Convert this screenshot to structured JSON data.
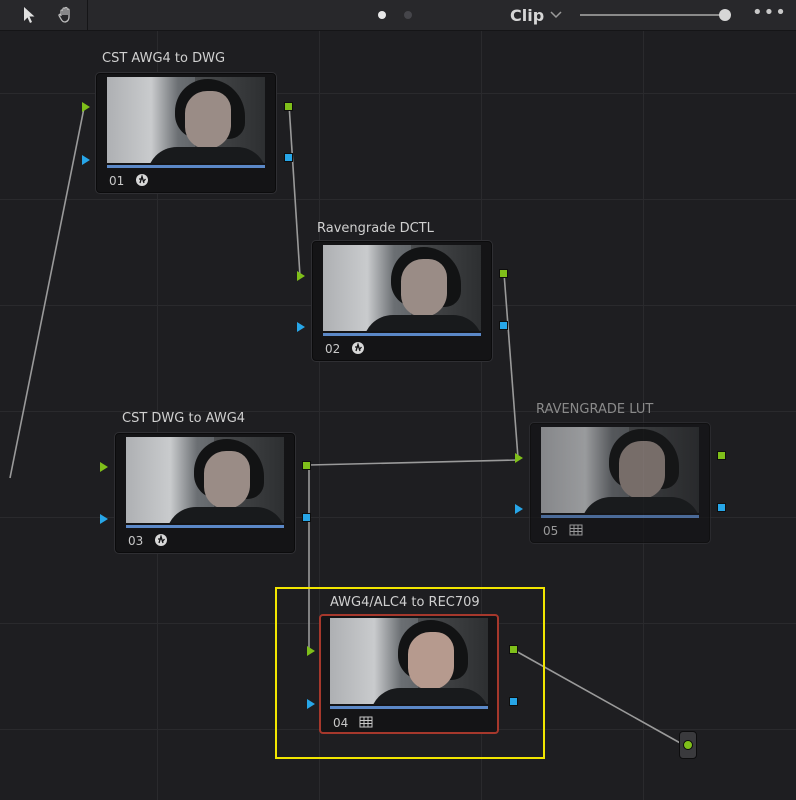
{
  "toolbar": {
    "pointer_icon": "pointer-arrow-icon",
    "hand_icon": "hand-pan-icon",
    "mode_label": "Clip",
    "more_icon": "more-dots-icon",
    "more_label": "•••"
  },
  "nodes": [
    {
      "title": "CST AWG4 to DWG",
      "number": "01",
      "icon": "fx-icon",
      "state": "normal"
    },
    {
      "title": "Ravengrade DCTL",
      "number": "02",
      "icon": "fx-icon",
      "state": "normal"
    },
    {
      "title": "CST DWG to AWG4",
      "number": "03",
      "icon": "fx-icon",
      "state": "normal"
    },
    {
      "title": "AWG4/ALC4 to REC709",
      "number": "04",
      "icon": "lut-grid-icon",
      "state": "selected"
    },
    {
      "title": "RAVENGRADE LUT",
      "number": "05",
      "icon": "lut-grid-icon",
      "state": "disabled"
    }
  ],
  "colors": {
    "rgb_port": "#7fbf1a",
    "alpha_port": "#27a6e8",
    "selection_frame": "#f2e600",
    "selected_node_border": "#a6382c"
  }
}
